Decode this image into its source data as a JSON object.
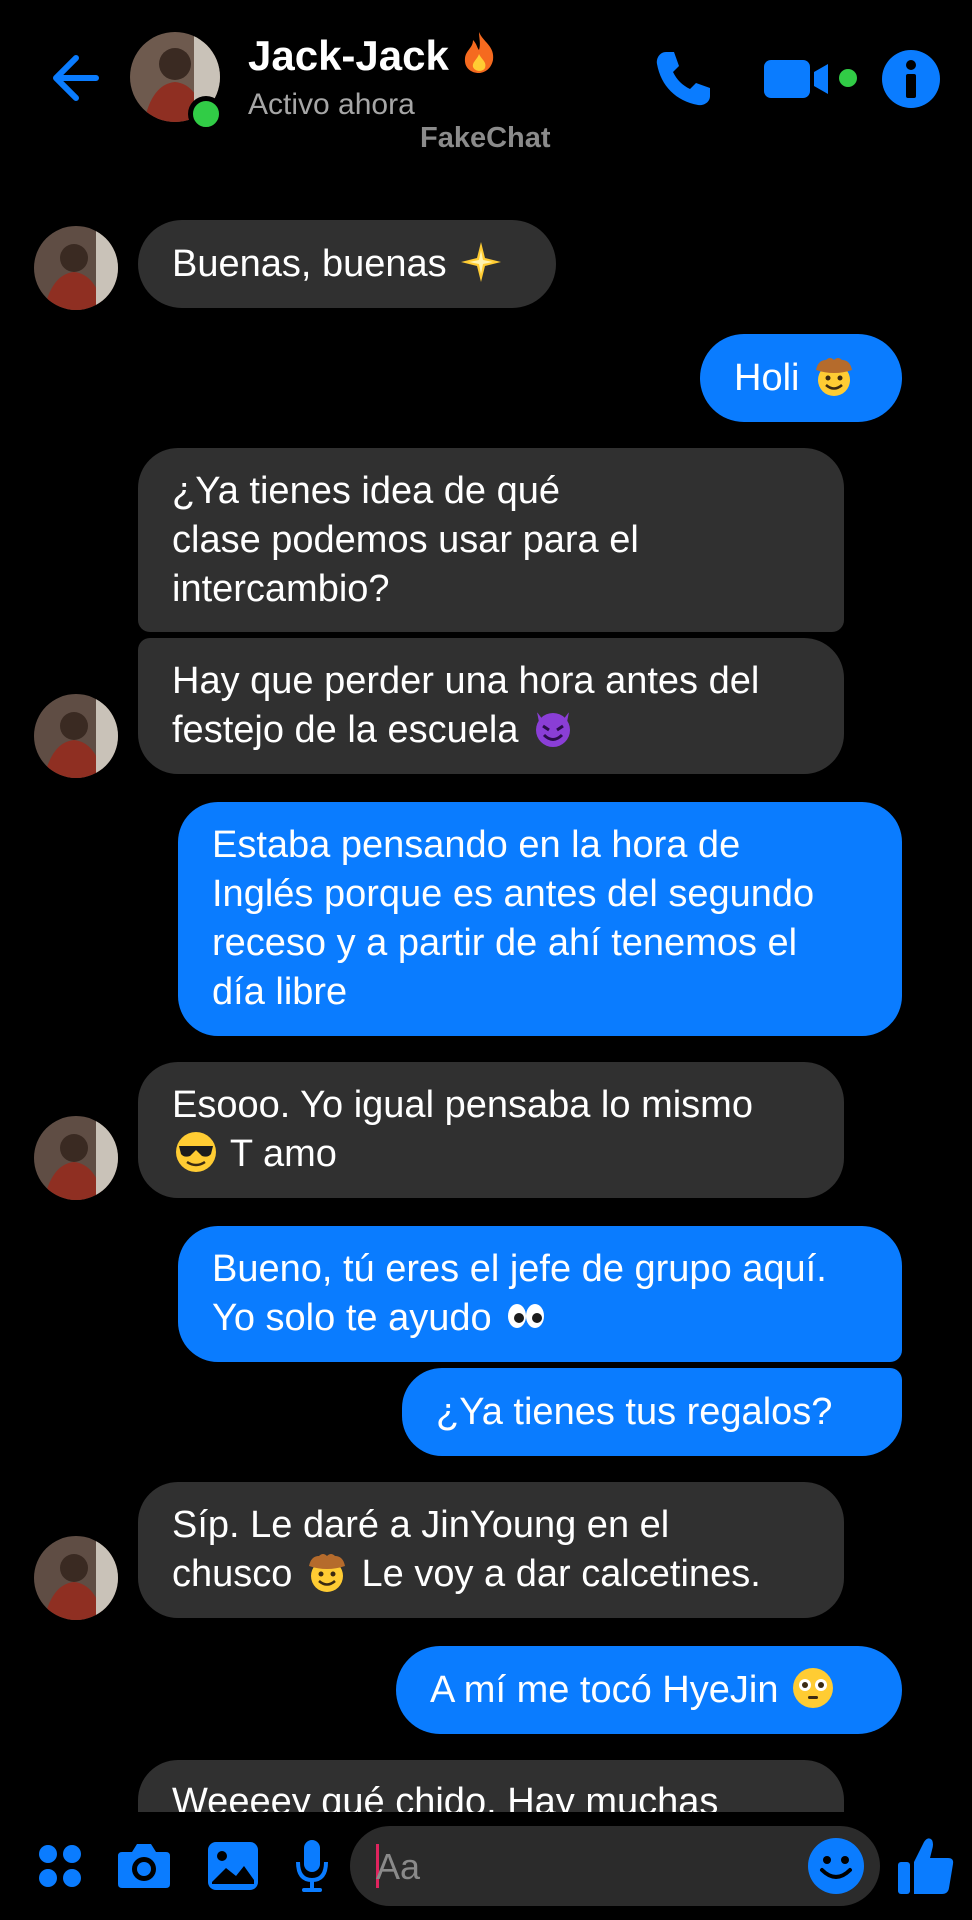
{
  "header": {
    "contact_name": "Jack-Jack",
    "status": "Activo ahora",
    "watermark": "FakeChat",
    "name_emoji": "fire-icon"
  },
  "colors": {
    "accent": "#0a7cff",
    "incoming_bubble": "#303030",
    "online": "#31cc46",
    "background": "#000000"
  },
  "messages": [
    {
      "dir": "in",
      "lines": [
        "Buenas, buenas",
        ""
      ],
      "emoji": "sparkle-icon"
    },
    {
      "dir": "out",
      "lines": [
        "Holi"
      ],
      "emoji": "cowboy-face-icon"
    },
    {
      "dir": "in",
      "lines": [
        "¿Ya tienes idea de qué",
        "clase podemos usar para el",
        "intercambio?"
      ]
    },
    {
      "dir": "in",
      "lines": [
        "Hay que perder una hora antes del",
        "festejo de la escuela"
      ],
      "emoji": "smiling-devil-icon"
    },
    {
      "dir": "out",
      "lines": [
        "Estaba pensando en la hora de",
        "Inglés porque es antes del segundo",
        "receso y a partir de ahí tenemos el",
        "día libre"
      ]
    },
    {
      "dir": "in",
      "lines": [
        "Esooo. Yo igual pensaba lo mismo",
        "T amo"
      ],
      "emoji": "sunglasses-face-icon"
    },
    {
      "dir": "out",
      "lines": [
        "Bueno, tú eres el jefe de grupo aquí.",
        "Yo solo te ayudo"
      ],
      "emoji": "eyes-icon"
    },
    {
      "dir": "out",
      "lines": [
        "¿Ya tienes tus regalos?"
      ]
    },
    {
      "dir": "in",
      "lines": [
        "Síp. Le daré a JinYoung en el",
        "chusco",
        "Le voy a dar calcetines."
      ],
      "emoji": "cowboy-face-icon"
    },
    {
      "dir": "out",
      "lines": [
        "A mí me tocó HyeJin"
      ],
      "emoji": "flushed-face-icon"
    },
    {
      "dir": "in",
      "lines": [
        "Weeeey qué chido. Hay muchas"
      ]
    }
  ],
  "composer": {
    "placeholder": "Aa",
    "icons": [
      "menu-dots-icon",
      "camera-icon",
      "gallery-icon",
      "microphone-icon",
      "emoji-icon",
      "thumbs-up-icon"
    ]
  }
}
